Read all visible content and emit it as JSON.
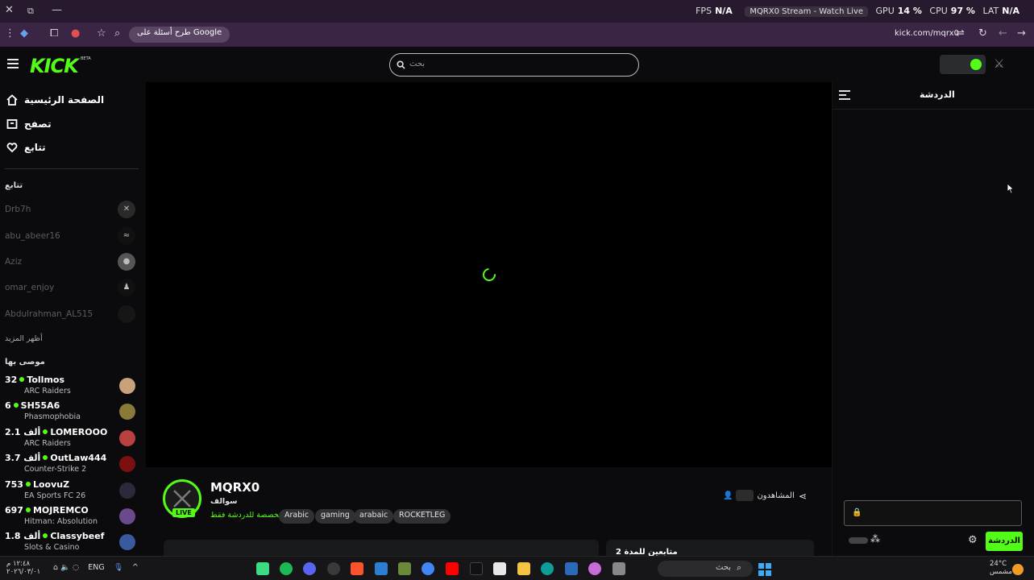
{
  "os": {
    "perf": {
      "fps_label": "FPS",
      "fps_val": "N/A",
      "gpu_label": "GPU",
      "gpu_val": "14 %",
      "cpu_label": "CPU",
      "cpu_val": "97 %",
      "lat_label": "LAT",
      "lat_val": "N/A"
    },
    "tab_title": "MQRX0 Stream - Watch Live",
    "clock_time": "١٢:٤٨ م",
    "clock_date": "٢٠٢٦/٠٣/٠١",
    "lang": "ENG",
    "weather_temp": "24°C",
    "weather_desc": "مشمس",
    "taskbar_search": "بحث"
  },
  "browser": {
    "google_chip": "طرح أسئلة على Google",
    "url": "kick.com/mqrx0"
  },
  "site": {
    "logo": "KICK",
    "beta": "BETA",
    "search_placeholder": "بحث"
  },
  "sidebar": {
    "nav": [
      {
        "label": "الصفحة الرئيسية"
      },
      {
        "label": "تصفح"
      },
      {
        "label": "تتابع"
      }
    ],
    "following_title": "تتابع",
    "following": [
      {
        "name": "Drb7h"
      },
      {
        "name": "abu_abeer16"
      },
      {
        "name": "Aziz"
      },
      {
        "name": "omar_enjoy"
      },
      {
        "name": "Abdulrahman_AL515"
      }
    ],
    "show_more": "أظهر المزيد",
    "recommended_title": "موصى بها",
    "recommended": [
      {
        "viewers": "32",
        "name": "Tollmos",
        "category": "ARC Raiders",
        "avatar_color": "#c9a27c"
      },
      {
        "viewers": "6",
        "name": "SH55A6",
        "category": "Phasmophobia",
        "avatar_color": "#8a7a3a"
      },
      {
        "viewers": "2.1 ألف",
        "name": "LOMEROOO",
        "category": "ARC Raiders",
        "avatar_color": "#b84040"
      },
      {
        "viewers": "3.7 ألف",
        "name": "OutLaw444",
        "category": "Counter-Strike 2",
        "avatar_color": "#7a1010"
      },
      {
        "viewers": "753",
        "name": "LoovuZ",
        "category": "EA Sports FC 26",
        "avatar_color": "#2a2a3a"
      },
      {
        "viewers": "697",
        "name": "MOJREMCO",
        "category": "Hitman: Absolution",
        "avatar_color": "#6a4a8a"
      },
      {
        "viewers": "1.8 ألف",
        "name": "Classybeef",
        "category": "Slots & Casino",
        "avatar_color": "#3a5aa0"
      }
    ]
  },
  "channel": {
    "name": "MQRX0",
    "category": "سوالف",
    "chat_mode": "مخصصة للدردشة فقط",
    "live": "LIVE",
    "tags": [
      "Arabic",
      "gaming",
      "arabaic",
      "ROCKETLEG"
    ],
    "viewers_label": "المشاهدون",
    "recent_followers": "متابعين للمدة 2"
  },
  "chat": {
    "title": "الدردشة",
    "send": "الدردشة"
  }
}
